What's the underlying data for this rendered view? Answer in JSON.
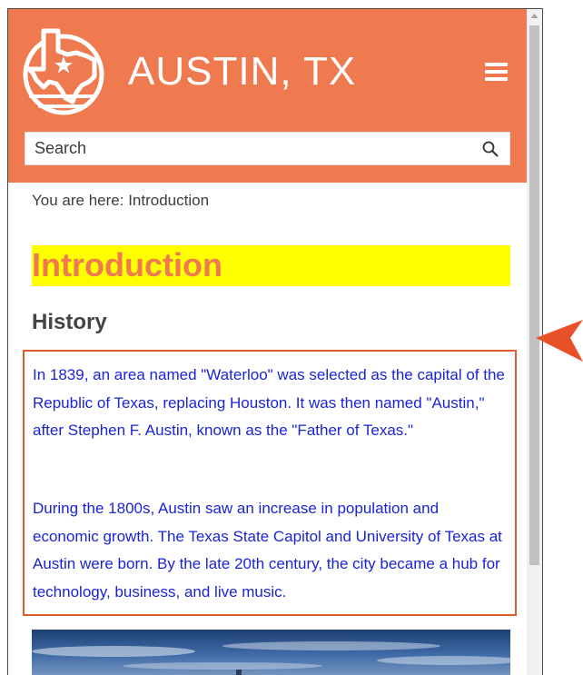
{
  "header": {
    "site_title": "AUSTIN, TX",
    "logo_icon": "texas-star-logo-icon",
    "menu_icon": "hamburger-menu-icon",
    "background_color": "#f07a4f"
  },
  "search": {
    "placeholder": "Search",
    "icon": "search-icon"
  },
  "breadcrumb": {
    "prefix": "You are here:",
    "current": "Introduction"
  },
  "main": {
    "title": "Introduction",
    "section_heading": "History",
    "paragraphs": [
      "In 1839, an area named \"Waterloo\" was selected as the capital of the Republic of Texas, replacing Houston. It was then named \"Austin,\" after Stephen F. Austin, known as the \"Father of Texas.\"",
      "During the 1800s, Austin saw an increase in population and economic growth. The Texas State Capitol and University of Texas at Austin were born. By the late 20th century, the city became a hub for technology, business, and live music."
    ]
  },
  "colors": {
    "accent": "#f07a4f",
    "highlight": "#ffff00",
    "body_text": "#1a24d6",
    "callout_border": "#e05a2b",
    "arrow": "#e8502a"
  }
}
